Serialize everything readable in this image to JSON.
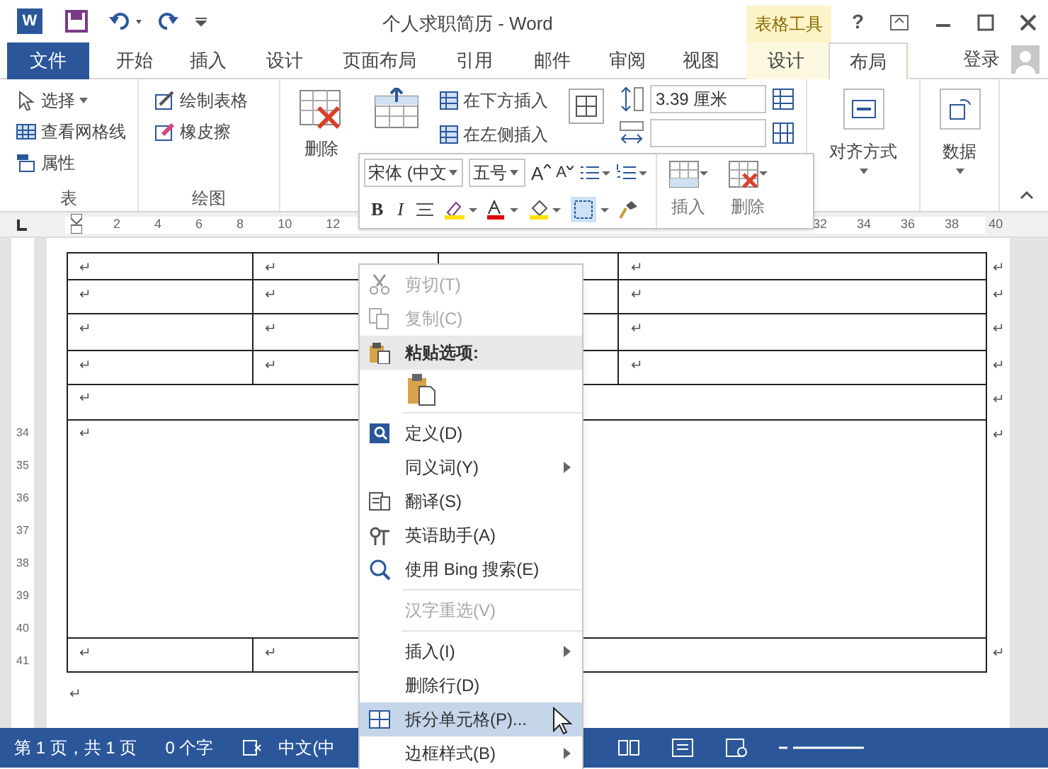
{
  "title_bar": {
    "app_letter": "W",
    "title": "个人求职简历 - Word",
    "context_tab": "表格工具",
    "help": "?"
  },
  "tabs": [
    {
      "label": "文件",
      "kind": "file",
      "selected": false
    },
    {
      "label": "开始",
      "kind": "normal",
      "selected": false
    },
    {
      "label": "插入",
      "kind": "normal",
      "selected": false
    },
    {
      "label": "设计",
      "kind": "normal",
      "selected": false
    },
    {
      "label": "页面布局",
      "kind": "normal",
      "selected": false
    },
    {
      "label": "引用",
      "kind": "normal",
      "selected": false
    },
    {
      "label": "邮件",
      "kind": "normal",
      "selected": false
    },
    {
      "label": "审阅",
      "kind": "normal",
      "selected": false
    },
    {
      "label": "视图",
      "kind": "normal",
      "selected": false
    },
    {
      "label": "设计",
      "kind": "context",
      "selected": false
    },
    {
      "label": "布局",
      "kind": "context",
      "selected": true
    }
  ],
  "account": "登录",
  "ribbon": {
    "table_group": {
      "label": "表",
      "items": [
        "选择",
        "查看网格线",
        "属性"
      ]
    },
    "draw_group": {
      "label": "绘图",
      "items": [
        "绘制表格",
        "橡皮擦"
      ]
    },
    "delete_button": "删除",
    "insert_items": [
      "在下方插入",
      "在左侧插入"
    ],
    "height_field": {
      "value": "3.39 厘米"
    },
    "align_button": "对齐方式",
    "data_button": "数据"
  },
  "mini_toolbar": {
    "font": "宋体 (中文",
    "size": "五号",
    "grow_font": "A",
    "shrink_font": "A",
    "bold": "B",
    "italic": "I",
    "insert": "插入",
    "delete": "删除"
  },
  "ruler": {
    "left_numbers": [
      "2",
      "4",
      "6",
      "8",
      "10",
      "12"
    ],
    "right_numbers": [
      "32",
      "34",
      "36",
      "38",
      "40"
    ]
  },
  "vertical_ruler": [
    "34",
    "35",
    "36",
    "37",
    "38",
    "39",
    "40",
    "41"
  ],
  "table": {
    "rows": [
      {
        "kind": "split",
        "cells": [
          "↵",
          "↵",
          null,
          "↵"
        ],
        "end_mark": "↵"
      },
      {
        "kind": "split",
        "cells": [
          "↵",
          "↵",
          null,
          "↵"
        ],
        "end_mark": "↵"
      },
      {
        "kind": "split",
        "cells": [
          "↵",
          "↵",
          null,
          "↵"
        ],
        "end_mark": "↵"
      },
      {
        "kind": "split",
        "cells": [
          "↵",
          "↵",
          null,
          "↵"
        ],
        "end_mark": "↵"
      },
      {
        "kind": "merged",
        "cells": [
          "↵"
        ],
        "end_mark": "↵"
      },
      {
        "kind": "merged",
        "cells": [
          "↵"
        ],
        "end_mark": "↵"
      },
      {
        "kind": "split3",
        "cells": [
          "↵",
          "↵",
          null
        ],
        "end_mark": "↵"
      }
    ],
    "after_mark": "↵"
  },
  "context_menu": [
    {
      "kind": "item",
      "label": "剪切(T)",
      "disabled": true,
      "submenu": false,
      "selected": false
    },
    {
      "kind": "item",
      "label": "复制(C)",
      "disabled": true,
      "submenu": false,
      "selected": false
    },
    {
      "kind": "header",
      "label": "粘贴选项:"
    },
    {
      "kind": "paste"
    },
    {
      "kind": "separator"
    },
    {
      "kind": "item",
      "label": "定义(D)",
      "disabled": false,
      "submenu": false,
      "selected": false
    },
    {
      "kind": "item",
      "label": "同义词(Y)",
      "disabled": false,
      "submenu": true,
      "selected": false
    },
    {
      "kind": "item",
      "label": "翻译(S)",
      "disabled": false,
      "submenu": false,
      "selected": false
    },
    {
      "kind": "item",
      "label": "英语助手(A)",
      "disabled": false,
      "submenu": false,
      "selected": false
    },
    {
      "kind": "item",
      "label": "使用 Bing 搜索(E)",
      "disabled": false,
      "submenu": false,
      "selected": false
    },
    {
      "kind": "separator"
    },
    {
      "kind": "item",
      "label": "汉字重选(V)",
      "disabled": true,
      "submenu": false,
      "selected": false
    },
    {
      "kind": "separator"
    },
    {
      "kind": "item",
      "label": "插入(I)",
      "disabled": false,
      "submenu": true,
      "selected": false
    },
    {
      "kind": "item",
      "label": "删除行(D)",
      "disabled": false,
      "submenu": false,
      "selected": false
    },
    {
      "kind": "item",
      "label": "拆分单元格(P)...",
      "disabled": false,
      "submenu": false,
      "selected": true
    },
    {
      "kind": "item",
      "label": "边框样式(B)",
      "disabled": false,
      "submenu": true,
      "selected": false
    }
  ],
  "status_bar": {
    "page": "第 1 页，共 1 页",
    "words": "0 个字",
    "language": "中文(中"
  }
}
